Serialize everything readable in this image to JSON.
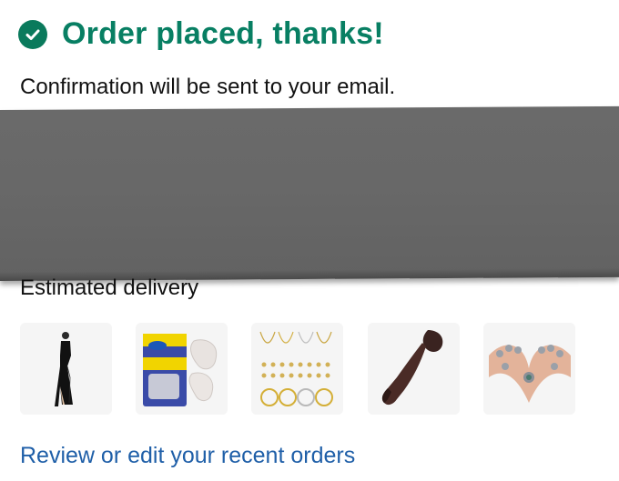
{
  "confirmation": {
    "title": "Order placed, thanks!",
    "subtitle": "Confirmation will be sent to your email.",
    "check_icon": "check-circle-icon",
    "accent_color": "#087f63"
  },
  "delivery": {
    "label": "Estimated delivery"
  },
  "items": [
    {
      "name": "product-thumbnail-black-dress"
    },
    {
      "name": "product-thumbnail-insoles"
    },
    {
      "name": "product-thumbnail-jewelry-set"
    },
    {
      "name": "product-thumbnail-adult-novelty"
    },
    {
      "name": "product-thumbnail-rings"
    }
  ],
  "footer": {
    "orders_link": "Review or edit your recent orders",
    "link_color": "#1f5fa8"
  }
}
